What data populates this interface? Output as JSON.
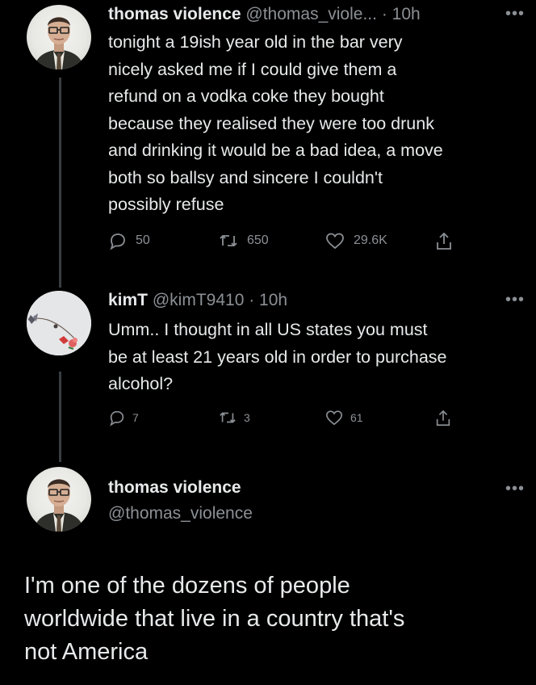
{
  "tweet1": {
    "name": "thomas violence",
    "handle": "@thomas_viole...",
    "time": "· 10h",
    "more": "•••",
    "text_lines": [
      "tonight a 19ish year old in the bar very",
      "nicely asked me if I could give them a",
      "refund on a vodka coke they bought",
      "because they realised they were too drunk",
      "and drinking it would be a bad idea, a move",
      "both so ballsy and sincere I couldn't",
      "possibly refuse"
    ],
    "replies": "50",
    "retweets": "650",
    "likes": "29.6K"
  },
  "tweet2": {
    "name": "kimT",
    "handle": "@kimT9410 · 10h",
    "more": "•••",
    "text_lines": [
      "Umm.. I thought in all US states you must",
      "be at least 21 years old in order to purchase",
      "alcohol?"
    ],
    "replies": "7",
    "retweets": "3",
    "likes": "61"
  },
  "tweet3": {
    "name": "thomas violence",
    "handle": "@thomas_violence",
    "more": "•••",
    "text_lines": [
      "I'm one of the dozens of people",
      "worldwide that live in a country that's",
      "not America"
    ]
  },
  "icons": {
    "reply": "reply-icon",
    "retweet": "retweet-icon",
    "like": "like-icon",
    "share": "share-icon"
  }
}
